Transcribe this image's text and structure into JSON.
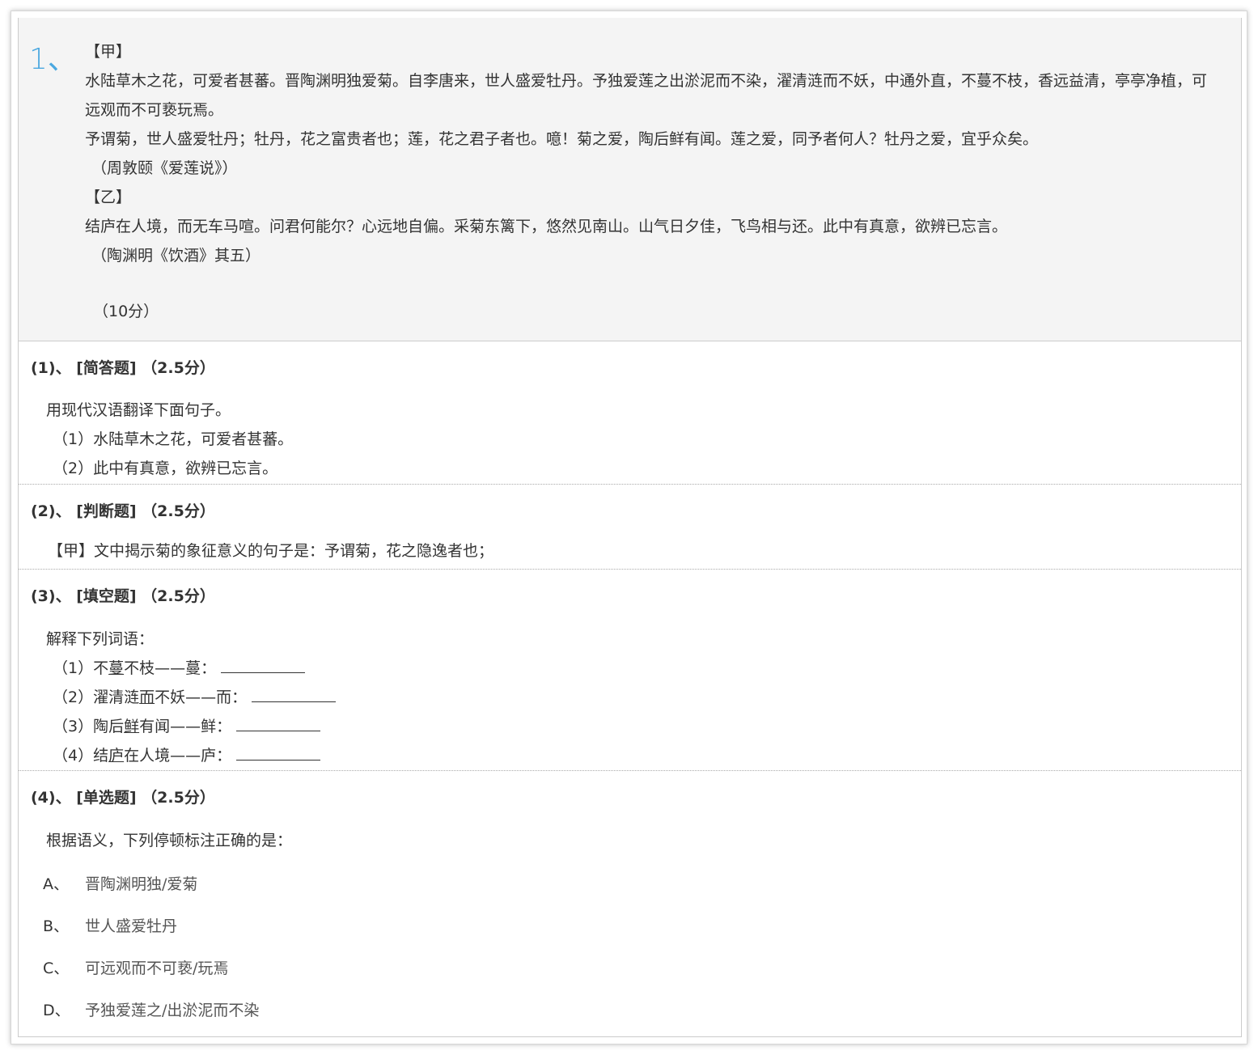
{
  "question": {
    "number": "1、",
    "stem": [
      "【甲】",
      "水陆草木之花，可爱者甚蕃。晋陶渊明独爱菊。自李唐来，世人盛爱牡丹。予独爱莲之出淤泥而不染，濯清涟而不妖，中通外直，不蔓不枝，香远益清，亭亭净植，可远观而不可亵玩焉。",
      "予谓菊，世人盛爱牡丹；牡丹，花之富贵者也；莲，花之君子者也。噫！菊之爱，陶后鲜有闻。莲之爱，同予者何人？牡丹之爱，宜乎众矣。",
      "（周敦颐《爱莲说》）",
      "【乙】",
      "结庐在人境，而无车马喧。问君何能尔？心远地自偏。采菊东篱下，悠然见南山。山气日夕佳，飞鸟相与还。此中有真意，欲辨已忘言。",
      "（陶渊明《饮酒》其五）"
    ],
    "score": "（10分）"
  },
  "subs": [
    {
      "title": "(1)、 [简答题] （2.5分）",
      "lines": [
        "用现代汉语翻译下面句子。",
        "（1）水陆草木之花，可爱者甚蕃。",
        "（2）此中有真意，欲辨已忘言。"
      ]
    },
    {
      "title": "(2)、 [判断题] （2.5分）",
      "line": "【甲】文中揭示菊的象征意义的句子是：予谓菊，花之隐逸者也；"
    },
    {
      "title": "(3)、 [填空题] （2.5分）",
      "intro": "解释下列词语：",
      "items": [
        {
          "pre": "（1）不",
          "u": "蔓",
          "post": "不枝——蔓："
        },
        {
          "pre": "（2）濯清涟",
          "u": "而",
          "post": "不妖——而："
        },
        {
          "pre": "（3）陶后",
          "u": "鲜",
          "post": "有闻——鲜："
        },
        {
          "pre": "（4）结",
          "u": "庐",
          "post": "在人境——庐："
        }
      ]
    },
    {
      "title": "(4)、 [单选题] （2.5分）",
      "intro": "根据语义，下列停顿标注正确的是：",
      "options": [
        {
          "label": "A、",
          "text": "晋陶渊明独/爱菊"
        },
        {
          "label": "B、",
          "text": "世人盛爱牡丹"
        },
        {
          "label": "C、",
          "text": "可远观而不可亵/玩焉"
        },
        {
          "label": "D、",
          "text": "予独爱莲之/出淤泥而不染"
        }
      ]
    }
  ]
}
